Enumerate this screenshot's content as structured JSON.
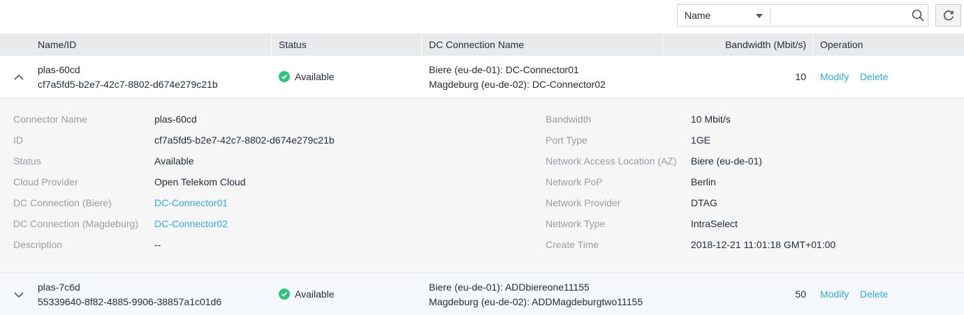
{
  "toolbar": {
    "filter_select": "Name",
    "search_placeholder": ""
  },
  "table": {
    "columns": {
      "name_id": "Name/ID",
      "status": "Status",
      "dc_connection_name": "DC Connection Name",
      "bandwidth": "Bandwidth (Mbit/s)",
      "operation": "Operation"
    },
    "rows": [
      {
        "name": "plas-60cd",
        "id": "cf7a5fd5-b2e7-42c7-8802-d674e279c21b",
        "status": "Available",
        "dc_line1": "Biere (eu-de-01): DC-Connector01",
        "dc_line2": "Magdeburg (eu-de-02): DC-Connector02",
        "bandwidth": "10",
        "modify": "Modify",
        "delete": "Delete",
        "expanded": true
      },
      {
        "name": "plas-7c6d",
        "id": "55339640-8f82-4885-9906-38857a1c01d6",
        "status": "Available",
        "dc_line1": "Biere (eu-de-01): ADDbiereone11155",
        "dc_line2": "Magdeburg (eu-de-02): ADDMagdeburgtwo11155",
        "bandwidth": "50",
        "modify": "Modify",
        "delete": "Delete",
        "expanded": false
      }
    ]
  },
  "detail": {
    "left": [
      {
        "label": "Connector Name",
        "value": "plas-60cd"
      },
      {
        "label": "ID",
        "value": "cf7a5fd5-b2e7-42c7-8802-d674e279c21b"
      },
      {
        "label": "Status",
        "value": "Available"
      },
      {
        "label": "Cloud Provider",
        "value": "Open Telekom Cloud"
      },
      {
        "label": "DC Connection (Biere)",
        "value": "DC-Connector01"
      },
      {
        "label": "DC Connection (Magdeburg)",
        "value": "DC-Connector02"
      },
      {
        "label": "Description",
        "value": "--"
      }
    ],
    "right": [
      {
        "label": "Bandwidth",
        "value": "10 Mbit/s"
      },
      {
        "label": "Port Type",
        "value": "1GE"
      },
      {
        "label": "Network Access Location (AZ)",
        "value": "Biere (eu-de-01)"
      },
      {
        "label": "Network PoP",
        "value": "Berlin"
      },
      {
        "label": "Network Provider",
        "value": "DTAG"
      },
      {
        "label": "Network Type",
        "value": "IntraSelect"
      },
      {
        "label": "Create Time",
        "value": "2018-12-21 11:01:18 GMT+01:00"
      }
    ]
  },
  "colors": {
    "link": "#33aadd",
    "status_available": "#2fc37a",
    "header_bg": "#e9eaec",
    "detail_bg": "#f6f6f7"
  },
  "icons": {
    "search": "search-icon",
    "refresh": "refresh-icon",
    "dropdown": "caret-down-icon",
    "collapse": "chevron-up-icon",
    "expand": "chevron-down-icon",
    "status": "check-circle-icon"
  }
}
